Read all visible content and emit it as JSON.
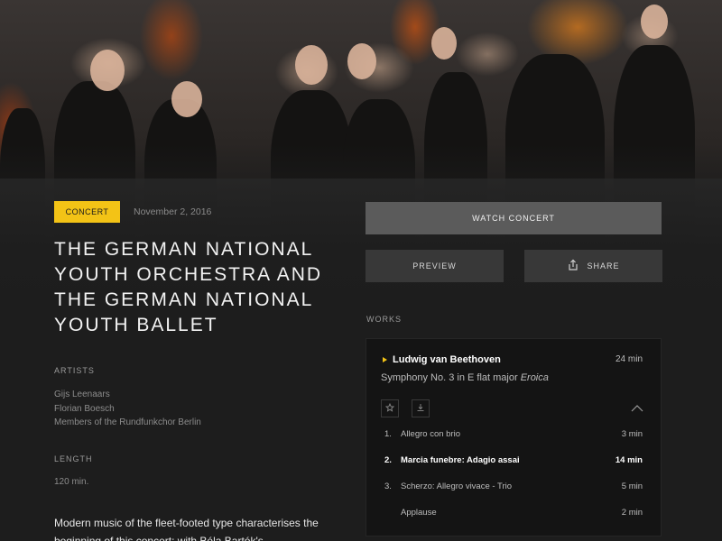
{
  "concert": {
    "category": "CONCERT",
    "date": "November 2, 2016",
    "title": "THE GERMAN NATIONAL YOUTH ORCHESTRA AND THE GERMAN NATIONAL YOUTH BALLET"
  },
  "actions": {
    "watch_label": "WATCH CONCERT",
    "preview_label": "PREVIEW",
    "share_label": "SHARE"
  },
  "artists": {
    "label": "ARTISTS",
    "names": [
      "Gijs Leenaars",
      "Florian Boesch",
      "Members of the Rundfunkchor Berlin"
    ]
  },
  "length": {
    "label": "LENGTH",
    "value": "120 min."
  },
  "description": "Modern music of the fleet-footed type characterises the beginning of this concert: with Béla Bartók's",
  "works": {
    "label": "WORKS",
    "items": [
      {
        "composer": "Ludwig van Beethoven",
        "duration": "24 min",
        "title_prefix": "Symphony No. 3 in E flat major ",
        "title_italic": "Eroica",
        "movements": [
          {
            "number": "1.",
            "name": "Allegro con brio",
            "duration": "3 min",
            "active": false
          },
          {
            "number": "2.",
            "name": "Marcia funebre: Adagio assai",
            "duration": "14 min",
            "active": true
          },
          {
            "number": "3.",
            "name": "Scherzo: Allegro vivace - Trio",
            "duration": "5 min",
            "active": false
          },
          {
            "number": "",
            "name": "Applause",
            "duration": "2 min",
            "active": false
          }
        ]
      }
    ]
  },
  "colors": {
    "accent": "#f3c316",
    "background": "#1c1c1c",
    "primary_button": "#5b5b5b",
    "secondary_button": "#383838"
  },
  "icons": [
    "share-icon",
    "play-icon",
    "star-icon",
    "download-icon",
    "chevron-up-icon"
  ]
}
